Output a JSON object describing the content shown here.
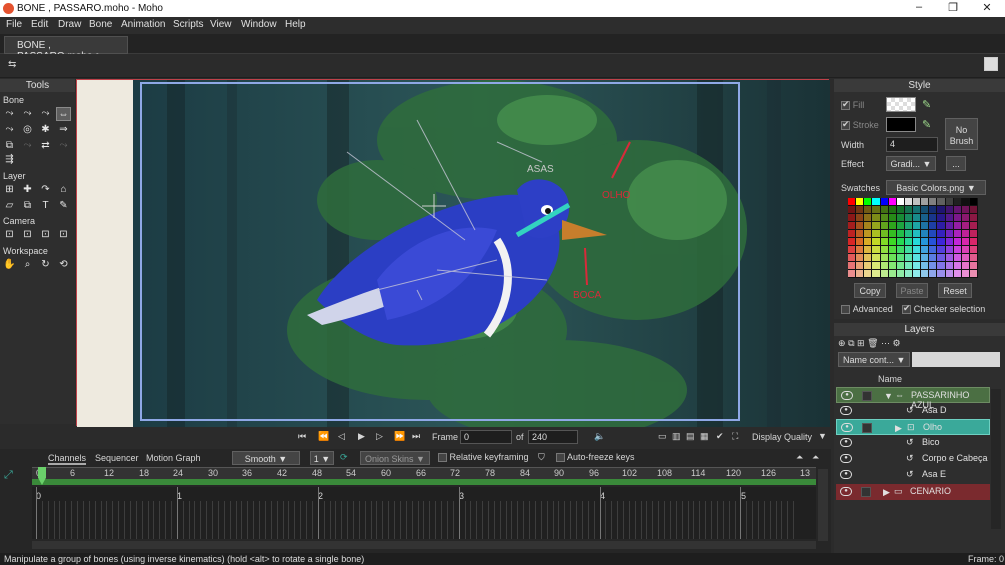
{
  "window": {
    "title": "BONE , PASSARO.moho - Moho",
    "minimize": "–",
    "maximize": "❐",
    "close": "✕"
  },
  "menu": [
    "File",
    "Edit",
    "Draw",
    "Bone",
    "Animation",
    "Scripts",
    "View",
    "Window",
    "Help"
  ],
  "document_tab": "BONE , PASSARO.moho",
  "tools": {
    "title": "Tools",
    "sections": [
      "Bone",
      "Layer",
      "Camera",
      "Workspace"
    ]
  },
  "style": {
    "title": "Style",
    "fill_label": "Fill",
    "stroke_label": "Stroke",
    "width_label": "Width",
    "width_value": "4",
    "effect_label": "Effect",
    "effect_value": "Gradi...",
    "effect_more": "...",
    "no_brush": "No Brush",
    "swatches_label": "Swatches",
    "swatches_value": "Basic Colors.png",
    "copy": "Copy",
    "paste": "Paste",
    "reset": "Reset",
    "advanced": "Advanced",
    "checker": "Checker selection",
    "fill_color": "#ffffff",
    "stroke_color": "#000000"
  },
  "layers": {
    "title": "Layers",
    "name_filter": "Name cont...",
    "col_name": "Name",
    "rows": [
      {
        "name": "PASSARINHO AZUL",
        "type": "bone",
        "depth": 0,
        "state": "selected-parent"
      },
      {
        "name": "Asa D",
        "type": "vector",
        "depth": 1,
        "state": "normal"
      },
      {
        "name": "Olho",
        "type": "group",
        "depth": 1,
        "state": "selected"
      },
      {
        "name": "Bico",
        "type": "vector",
        "depth": 1,
        "state": "normal"
      },
      {
        "name": "Corpo e Cabeça",
        "type": "vector",
        "depth": 1,
        "state": "normal"
      },
      {
        "name": "Asa E",
        "type": "vector",
        "depth": 1,
        "state": "normal"
      },
      {
        "name": "CENARIO",
        "type": "group",
        "depth": 0,
        "state": "red"
      }
    ]
  },
  "canvas": {
    "labels": [
      "ASAS",
      "OLHO",
      "BOCA"
    ]
  },
  "playback": {
    "frame_label": "Frame",
    "frame_value": "0",
    "of_label": "of",
    "total": "240",
    "display_quality": "Display Quality"
  },
  "timeline": {
    "tabs": [
      "Channels",
      "Sequencer",
      "Motion Graph"
    ],
    "interp": "Smooth",
    "interp_num": "1",
    "onion": "Onion Skins",
    "relative": "Relative keyframing",
    "autofreeze": "Auto-freeze keys",
    "frame_ticks": [
      "0",
      "6",
      "12",
      "18",
      "24",
      "30",
      "36",
      "42",
      "48",
      "54",
      "60",
      "66",
      "72",
      "78",
      "84",
      "90",
      "96",
      "102",
      "108",
      "114",
      "120",
      "126",
      "13"
    ],
    "seconds": [
      "0",
      "1",
      "2",
      "3",
      "4",
      "5"
    ]
  },
  "status": {
    "message": "Manipulate a group of bones (using inverse kinematics) (hold <alt> to rotate a single bone)",
    "frame": "Frame: 0"
  },
  "colors": {
    "accent_teal": "#3aa99a",
    "timeline_green": "#3a8a3a",
    "selection_red": "#c0424a",
    "bird_blue": "#2b3ec4"
  }
}
